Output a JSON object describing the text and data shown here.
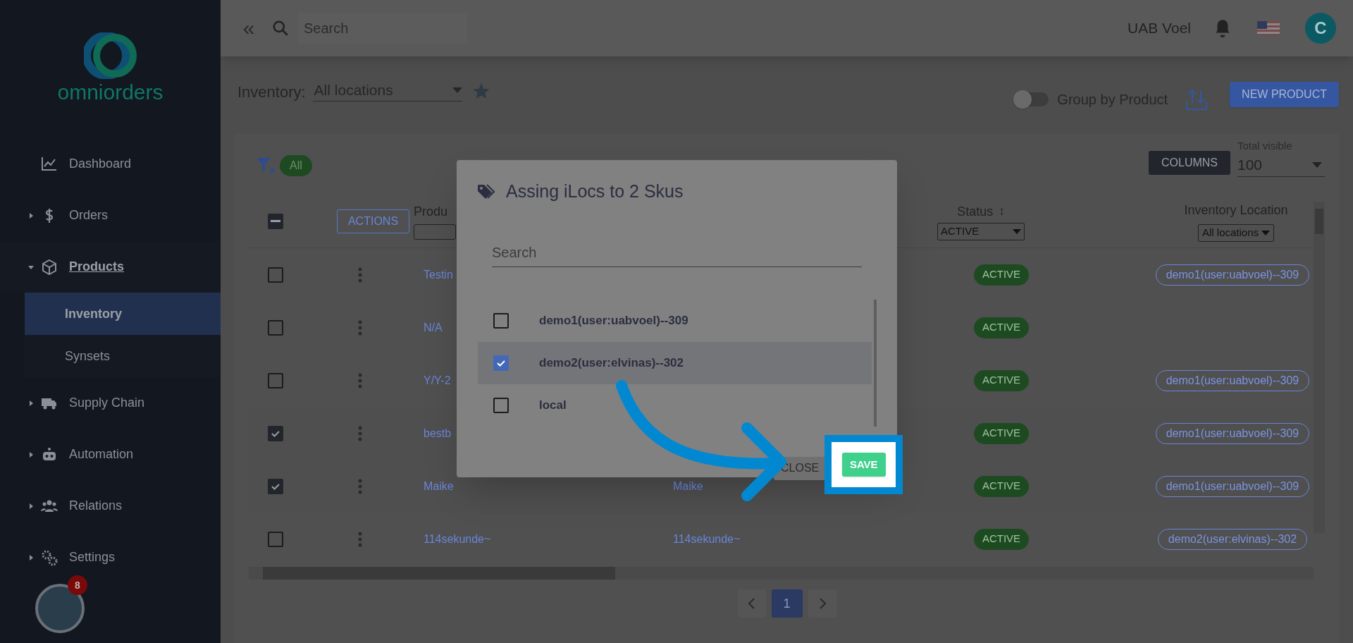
{
  "sidebar": {
    "logo_text": "omniorders",
    "items": [
      {
        "label": "Dashboard",
        "kind": "link",
        "selected": false
      },
      {
        "label": "Orders",
        "kind": "group",
        "expanded": false,
        "selected": false
      },
      {
        "label": "Products",
        "kind": "group",
        "expanded": true,
        "selected": true,
        "children": [
          {
            "label": "Inventory",
            "selected": true
          },
          {
            "label": "Synsets",
            "selected": false
          }
        ]
      },
      {
        "label": "Supply Chain",
        "kind": "group",
        "expanded": false,
        "selected": false
      },
      {
        "label": "Automation",
        "kind": "group",
        "expanded": false,
        "selected": false
      },
      {
        "label": "Relations",
        "kind": "group",
        "expanded": false,
        "selected": false
      },
      {
        "label": "Settings",
        "kind": "group",
        "expanded": false,
        "selected": false
      }
    ],
    "notification_count": "8"
  },
  "topbar": {
    "collapse_glyph": "«",
    "search_placeholder": "Search",
    "company": "UAB Voel",
    "avatar_letter": "C"
  },
  "page": {
    "title": "Inventory:",
    "location_select": "All locations",
    "group_by_product": {
      "label": "Group by Product",
      "on": false
    },
    "new_product_button": "NEW PRODUCT"
  },
  "toolbar": {
    "filter_chip": "All",
    "columns_button": "COLUMNS",
    "total_visible": {
      "label": "Total visible",
      "value": "100"
    }
  },
  "table": {
    "select_all": {
      "indeterminate": true
    },
    "actions_button": "ACTIONS",
    "product_header": "Produ",
    "status_header": {
      "label": "Status",
      "sort_glyph": "↕",
      "filter": "ACTIVE"
    },
    "location_header": {
      "label": "Inventory Location",
      "filter": "All locations"
    },
    "rows": [
      {
        "checked": false,
        "product": "Testin",
        "column_3": "",
        "status": "ACTIVE",
        "location": "demo1(user:uabvoel)--309"
      },
      {
        "checked": false,
        "product": "N/A",
        "column_3": "",
        "status": "ACTIVE",
        "location": ""
      },
      {
        "checked": false,
        "product": "Y/Y-2",
        "column_3": "",
        "status": "ACTIVE",
        "location": "demo1(user:uabvoel)--309"
      },
      {
        "checked": true,
        "product": "bestb",
        "column_3": "",
        "status": "ACTIVE",
        "location": "demo1(user:uabvoel)--309"
      },
      {
        "checked": true,
        "product": "Maike",
        "column_3": "Maike",
        "status": "ACTIVE",
        "location": "demo1(user:uabvoel)--309"
      },
      {
        "checked": false,
        "product": "114sekunde~",
        "column_3": "114sekunde~",
        "status": "ACTIVE",
        "location": "demo2(user:elvinas)--302"
      }
    ],
    "pagination": {
      "current_page": "1"
    }
  },
  "dialog": {
    "title": "Assing iLocs to 2 Skus",
    "search_placeholder": "Search",
    "options": [
      {
        "label": "demo1(user:uabvoel)--309",
        "checked": false,
        "selected": false
      },
      {
        "label": "demo2(user:elvinas)--302",
        "checked": true,
        "selected": true
      },
      {
        "label": "local",
        "checked": false,
        "selected": false
      }
    ],
    "close_button": "CLOSE",
    "save_button": "SAVE"
  }
}
